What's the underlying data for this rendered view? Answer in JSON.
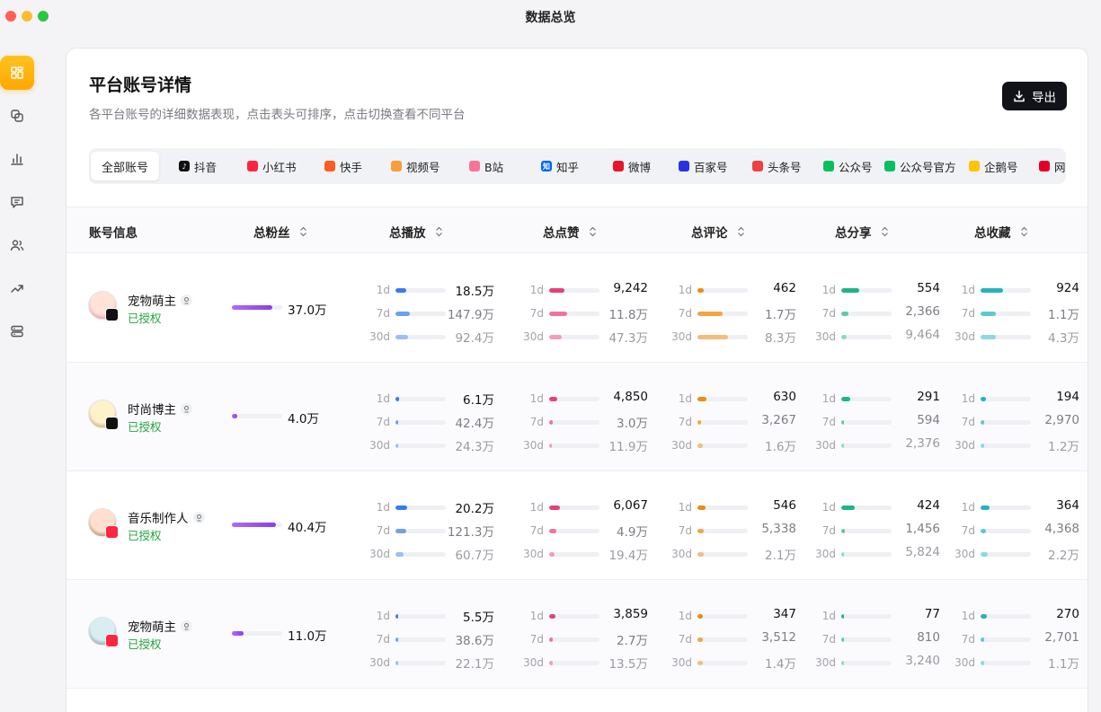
{
  "window": {
    "title": "数据总览",
    "traffic_lights": [
      "#ff5f57",
      "#febc2e",
      "#28c840"
    ]
  },
  "sidebar": {
    "items": [
      {
        "icon": "dashboard-icon",
        "active": true
      },
      {
        "icon": "copy-icon",
        "active": false
      },
      {
        "icon": "bar-chart-icon",
        "active": false
      },
      {
        "icon": "message-icon",
        "active": false
      },
      {
        "icon": "users-icon",
        "active": false
      },
      {
        "icon": "trend-icon",
        "active": false
      },
      {
        "icon": "server-icon",
        "active": false
      }
    ]
  },
  "header": {
    "title": "平台账号详情",
    "subtitle": "各平台账号的详细数据表现，点击表头可排序，点击切换查看不同平台",
    "export_label": "导出"
  },
  "tabs": [
    {
      "label": "全部账号",
      "active": true
    },
    {
      "label": "抖音",
      "icon": "douyin-icon",
      "color": "#111111",
      "glyph": "♪"
    },
    {
      "label": "小红书",
      "icon": "xiaohongshu-icon",
      "color": "#ff2442",
      "glyph": ""
    },
    {
      "label": "快手",
      "icon": "kuaishou-icon",
      "color": "#ff5a1f",
      "glyph": ""
    },
    {
      "label": "视频号",
      "icon": "shipinhao-icon",
      "color": "#fa9d3b",
      "glyph": ""
    },
    {
      "label": "B站",
      "icon": "bilibili-icon",
      "color": "#fb7299",
      "glyph": ""
    },
    {
      "label": "知乎",
      "icon": "zhihu-icon",
      "color": "#0066ff",
      "glyph": "知"
    },
    {
      "label": "微博",
      "icon": "weibo-icon",
      "color": "#e6162d",
      "glyph": ""
    },
    {
      "label": "百家号",
      "icon": "baijiahao-icon",
      "color": "#2932e1",
      "glyph": ""
    },
    {
      "label": "头条号",
      "icon": "toutiao-icon",
      "color": "#f04142",
      "glyph": ""
    },
    {
      "label": "公众号",
      "icon": "wechat-icon",
      "color": "#07c160",
      "glyph": ""
    },
    {
      "label": "公众号官方",
      "icon": "wechat-official-icon",
      "color": "#07c160",
      "glyph": ""
    },
    {
      "label": "企鹅号",
      "icon": "qiehao-icon",
      "color": "#ffc300",
      "glyph": ""
    },
    {
      "label": "网",
      "icon": "wangyi-icon",
      "color": "#e60026",
      "glyph": ""
    }
  ],
  "columns": {
    "account": "账号信息",
    "fans": "总粉丝",
    "plays": "总播放",
    "likes": "总点赞",
    "comments": "总评论",
    "shares": "总分享",
    "favorites": "总收藏"
  },
  "periods": [
    "1d",
    "7d",
    "30d"
  ],
  "rows": [
    {
      "name": "宠物萌主",
      "status": "已授权",
      "platform_badge": "douyin-icon",
      "fans": "37.0万",
      "fans_level": 0.8,
      "plays": [
        "18.5万",
        "147.9万",
        "92.4万"
      ],
      "plays_level": [
        0.22,
        0.28,
        0.25
      ],
      "likes": [
        "9,242",
        "11.8万",
        "47.3万"
      ],
      "likes_level": [
        0.3,
        0.35,
        0.25
      ],
      "comments": [
        "462",
        "1.7万",
        "8.3万"
      ],
      "comments_level": [
        0.12,
        0.5,
        0.6
      ],
      "shares": [
        "554",
        "2,366",
        "9,464"
      ],
      "shares_level": [
        0.35,
        0.15,
        0.1
      ],
      "favorites": [
        "924",
        "1.1万",
        "4.3万"
      ],
      "favorites_level": [
        0.45,
        0.3,
        0.3
      ]
    },
    {
      "name": "时尚博主",
      "status": "已授权",
      "platform_badge": "douyin-icon",
      "fans": "4.0万",
      "fans_level": 0.1,
      "plays": [
        "6.1万",
        "42.4万",
        "24.3万"
      ],
      "plays_level": [
        0.08,
        0.06,
        0.06
      ],
      "likes": [
        "4,850",
        "3.0万",
        "11.9万"
      ],
      "likes_level": [
        0.16,
        0.08,
        0.06
      ],
      "comments": [
        "630",
        "3,267",
        "1.6万"
      ],
      "comments_level": [
        0.18,
        0.08,
        0.1
      ],
      "shares": [
        "291",
        "594",
        "2,376"
      ],
      "shares_level": [
        0.18,
        0.04,
        0.03
      ],
      "favorites": [
        "194",
        "2,970",
        "1.2万"
      ],
      "favorites_level": [
        0.1,
        0.08,
        0.08
      ]
    },
    {
      "name": "音乐制作人",
      "status": "已授权",
      "platform_badge": "xiaohongshu-icon",
      "fans": "40.4万",
      "fans_level": 0.88,
      "plays": [
        "20.2万",
        "121.3万",
        "60.7万"
      ],
      "plays_level": [
        0.24,
        0.22,
        0.16
      ],
      "likes": [
        "6,067",
        "4.9万",
        "19.4万"
      ],
      "likes_level": [
        0.22,
        0.14,
        0.1
      ],
      "comments": [
        "546",
        "5,338",
        "2.1万"
      ],
      "comments_level": [
        0.16,
        0.12,
        0.12
      ],
      "shares": [
        "424",
        "1,456",
        "5,824"
      ],
      "shares_level": [
        0.26,
        0.08,
        0.06
      ],
      "favorites": [
        "364",
        "4,368",
        "2.2万"
      ],
      "favorites_level": [
        0.18,
        0.1,
        0.14
      ]
    },
    {
      "name": "宠物萌主",
      "status": "已授权",
      "platform_badge": "xiaohongshu-icon",
      "fans": "11.0万",
      "fans_level": 0.24,
      "plays": [
        "5.5万",
        "38.6万",
        "22.1万"
      ],
      "plays_level": [
        0.06,
        0.06,
        0.06
      ],
      "likes": [
        "3,859",
        "2.7万",
        "13.5万"
      ],
      "likes_level": [
        0.12,
        0.08,
        0.08
      ],
      "comments": [
        "347",
        "3,512",
        "1.4万"
      ],
      "comments_level": [
        0.1,
        0.1,
        0.1
      ],
      "shares": [
        "77",
        "810",
        "3,240"
      ],
      "shares_level": [
        0.05,
        0.05,
        0.04
      ],
      "favorites": [
        "270",
        "2,701",
        "1.1万"
      ],
      "favorites_level": [
        0.12,
        0.08,
        0.08
      ]
    }
  ],
  "metric_colors": {
    "plays": [
      "#3b7bea",
      "#6f9ff0",
      "#9dbdf5"
    ],
    "likes": [
      "#e83f7a",
      "#ef73a1",
      "#f39bbd"
    ],
    "comments": [
      "#ef8a12",
      "#f3a545",
      "#f4bc7a"
    ],
    "shares": [
      "#1cb684",
      "#5ccba4",
      "#8ddbbf"
    ],
    "favorites": [
      "#25b2c0",
      "#5ec8d2",
      "#8ed9e0"
    ]
  }
}
